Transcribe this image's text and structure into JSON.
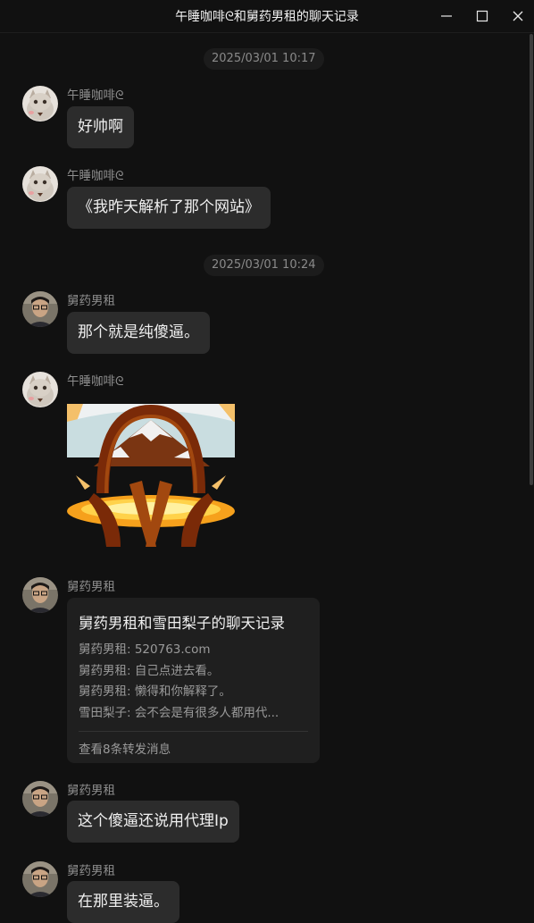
{
  "window": {
    "title": "午睡咖啡ᘓ和舅药男租的聊天记录"
  },
  "messages": {
    "ts1": "2025/03/01 10:17",
    "ts2": "2025/03/01 10:24",
    "m1": {
      "sender": "午睡咖啡ᘓ",
      "text": "好帅啊"
    },
    "m2": {
      "sender": "午睡咖啡ᘓ",
      "text": "《我昨天解析了那个网站》"
    },
    "m3": {
      "sender": "舅药男租",
      "text": "那个就是纯傻逼。"
    },
    "m4": {
      "sender": "午睡咖啡ᘓ"
    },
    "m5": {
      "sender": "舅药男租",
      "forward": {
        "title": "舅药男租和雪田梨子的聊天记录",
        "lines": [
          "舅药男租: 520763.com",
          "舅药男租: 自己点进去看。",
          "舅药男租: 懒得和你解释了。",
          "雪田梨子: 会不会是有很多人都用代..."
        ],
        "footer": "查看8条转发消息"
      }
    },
    "m6": {
      "sender": "舅药男租",
      "text": "这个傻逼还说用代理Ip"
    },
    "m7": {
      "sender": "舅药男租",
      "text": "在那里装逼。"
    }
  },
  "colors": {
    "background": "#111111",
    "bubble": "#2c2c2c",
    "forward_card": "#1f1f1f",
    "sender_text": "#8f8f8f"
  }
}
